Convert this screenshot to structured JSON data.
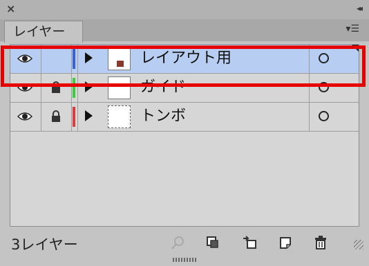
{
  "panel": {
    "tab_label": "レイヤー",
    "count_label": "3レイヤー"
  },
  "layers": [
    {
      "name": "レイアウト用",
      "color": "#3a62d8",
      "locked": false,
      "selected": true
    },
    {
      "name": "ガイド",
      "color": "#3ccf3c",
      "locked": true,
      "selected": false
    },
    {
      "name": "トンボ",
      "color": "#e03a3a",
      "locked": true,
      "selected": false
    }
  ],
  "icons": {
    "close": "close-icon",
    "collapse": "collapse-icon",
    "menu": "panel-menu-icon",
    "visibility": "eye-icon",
    "lock": "lock-icon",
    "expand": "disclosure-triangle-icon",
    "target": "target-circle-icon",
    "search": "locate-object-icon",
    "clip": "clipping-mask-icon",
    "sublayer": "new-sublayer-icon",
    "newlayer": "new-layer-icon",
    "trash": "trash-icon"
  },
  "colors": {
    "selection": "#b8cdf2",
    "highlight_box": "#e60000"
  }
}
